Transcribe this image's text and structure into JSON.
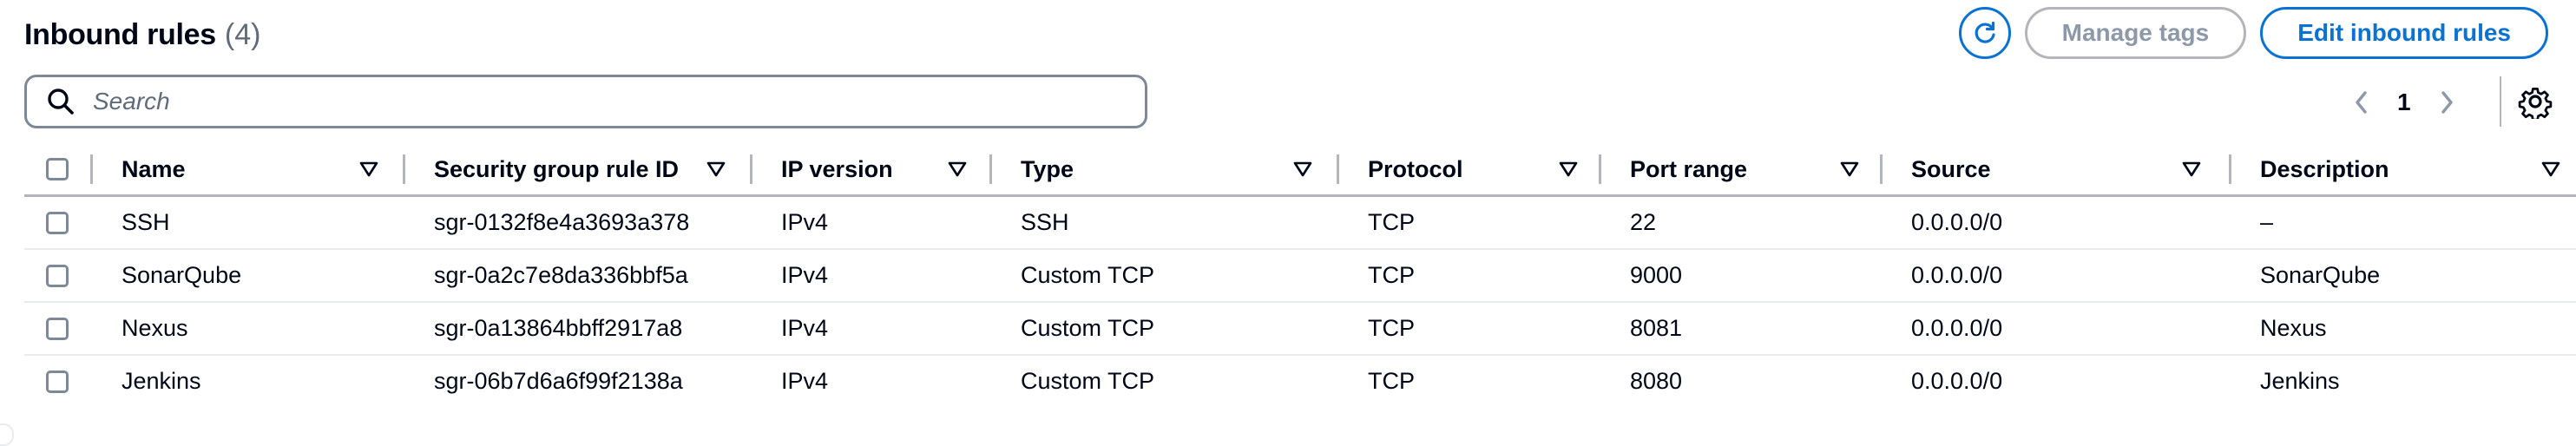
{
  "header": {
    "title": "Inbound rules",
    "count": "(4)"
  },
  "actions": {
    "manage_tags": "Manage tags",
    "edit_inbound": "Edit inbound rules",
    "refresh_icon": "refresh-icon"
  },
  "search": {
    "placeholder": "Search",
    "value": ""
  },
  "pagination": {
    "current_page": "1"
  },
  "table": {
    "columns": [
      "Name",
      "Security group rule ID",
      "IP version",
      "Type",
      "Protocol",
      "Port range",
      "Source",
      "Description"
    ],
    "rows": [
      [
        "SSH",
        "sgr-0132f8e4a3693a378",
        "IPv4",
        "SSH",
        "TCP",
        "22",
        "0.0.0.0/0",
        "–"
      ],
      [
        "SonarQube",
        "sgr-0a2c7e8da336bbf5a",
        "IPv4",
        "Custom TCP",
        "TCP",
        "9000",
        "0.0.0.0/0",
        "SonarQube"
      ],
      [
        "Nexus",
        "sgr-0a13864bbff2917a8",
        "IPv4",
        "Custom TCP",
        "TCP",
        "8081",
        "0.0.0.0/0",
        "Nexus"
      ],
      [
        "Jenkins",
        "sgr-06b7d6a6f99f2138a",
        "IPv4",
        "Custom TCP",
        "TCP",
        "8080",
        "0.0.0.0/0",
        "Jenkins"
      ]
    ]
  },
  "colors": {
    "accent": "#0972d3",
    "text": "#000716",
    "muted": "#5f6b7a",
    "border": "#b4b4bb"
  }
}
